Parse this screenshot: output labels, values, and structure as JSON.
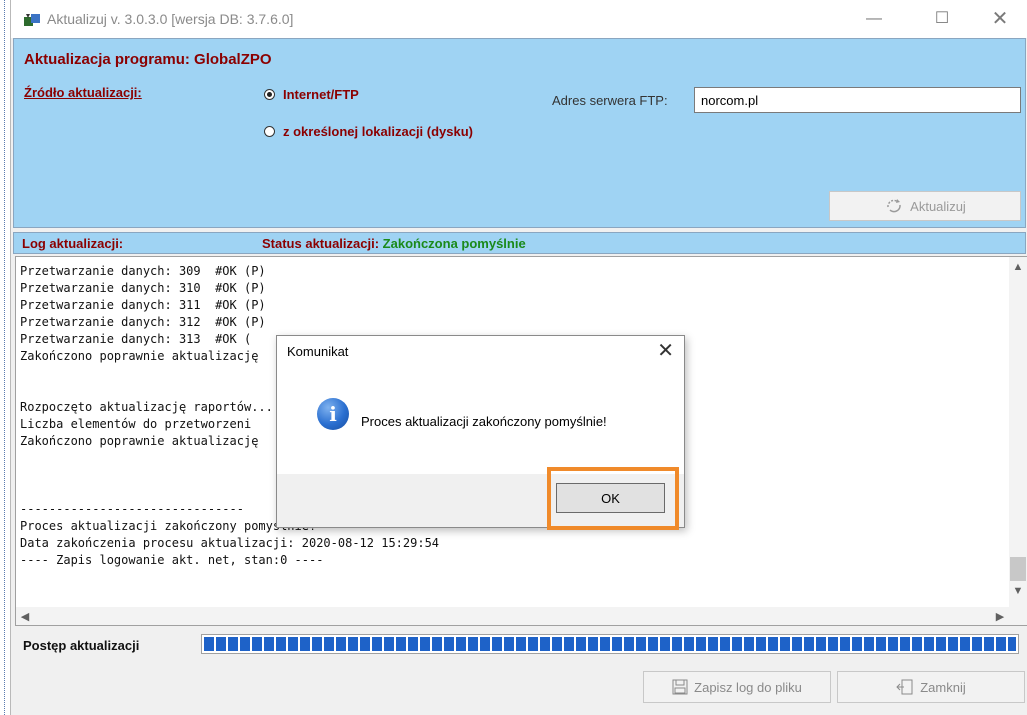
{
  "window": {
    "title": "Aktualizuj v. 3.0.3.0 [wersja DB: 3.7.6.0]",
    "minimize_glyph": "—",
    "maximize_glyph": "☐",
    "close_glyph": "✕"
  },
  "update_panel": {
    "heading": "Aktualizacja programu: GlobalZPO",
    "source_label": "Źródło aktualizacji:",
    "radio_internet_label": "Internet/FTP",
    "radio_internet_selected": true,
    "radio_local_label": "z określonej lokalizacji (dysku)",
    "radio_local_selected": false,
    "ftp_label": "Adres serwera FTP:",
    "ftp_value": "norcom.pl",
    "update_button_label": "Aktualizuj"
  },
  "log": {
    "label": "Log aktualizacji:",
    "status_label": "Status aktualizacji:",
    "status_value": "Zakończona pomyślnie",
    "status_color": "#1a8a1a",
    "lines": [
      "Przetwarzanie danych: 309  #OK (P)",
      "Przetwarzanie danych: 310  #OK (P)",
      "Przetwarzanie danych: 311  #OK (P)",
      "Przetwarzanie danych: 312  #OK (P)",
      "Przetwarzanie danych: 313  #OK (",
      "Zakończono poprawnie aktualizację",
      "",
      "",
      "Rozpoczęto aktualizację raportów...",
      "Liczba elementów do przetworzeni",
      "Zakończono poprawnie aktualizację",
      "",
      "",
      "",
      "-------------------------------",
      "Proces aktualizacji zakończony pomyślnie!",
      "Data zakończenia procesu aktualizacji: 2020-08-12 15:29:54",
      "---- Zapis logowanie akt. net, stan:0 ----"
    ]
  },
  "progress": {
    "label": "Postęp aktualizacji",
    "value_percent": 100,
    "bar_color": "#1e62c8"
  },
  "bottom_buttons": {
    "save_label": "Zapisz log do pliku",
    "close_label": "Zamknij"
  },
  "dialog": {
    "title": "Komunikat",
    "message": "Proces aktualizacji zakończony pomyślnie!",
    "ok_label": "OK",
    "close_glyph": "✕",
    "highlight_color": "#f08a2a"
  },
  "colors": {
    "panel_bg": "#9fd3f3",
    "heading_color": "#8b0000"
  }
}
